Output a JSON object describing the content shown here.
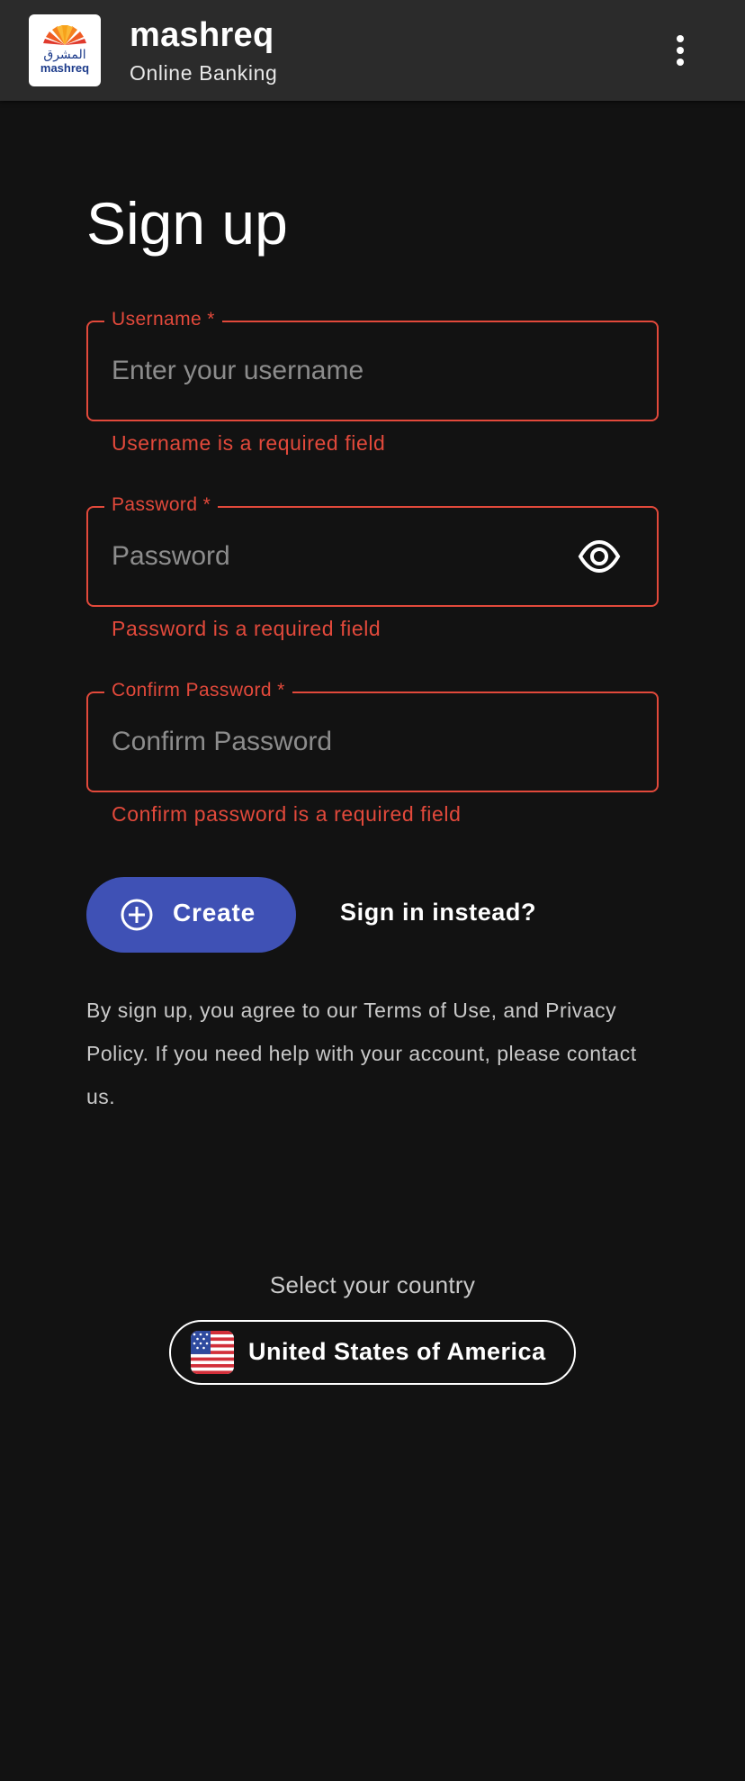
{
  "header": {
    "logo_arabic": "المشرق",
    "logo_latin": "mashreq",
    "brand": "mashreq",
    "subtitle": "Online Banking",
    "menu_icon": "more-vert-icon"
  },
  "page": {
    "title": "Sign up"
  },
  "form": {
    "username": {
      "label": "Username *",
      "placeholder": "Enter your username",
      "value": "",
      "error": "Username is a required field"
    },
    "password": {
      "label": "Password *",
      "placeholder": "Password",
      "value": "",
      "error": "Password is a required field",
      "toggle_icon": "eye-icon"
    },
    "confirm_password": {
      "label": "Confirm Password *",
      "placeholder": "Confirm Password",
      "value": "",
      "error": "Confirm password is a required field"
    },
    "create_label": "Create",
    "create_icon": "add-circle-icon",
    "signin_label": "Sign in instead?"
  },
  "terms": {
    "text": "By sign up, you agree to our Terms of Use, and Privacy Policy. If you need help with your account, please contact us."
  },
  "country": {
    "label": "Select your country",
    "selected": "United States of America",
    "flag_icon": "us-flag-icon"
  },
  "colors": {
    "background": "#121212",
    "appbar": "#2b2b2b",
    "error": "#e2493b",
    "primary": "#3f51b5"
  }
}
